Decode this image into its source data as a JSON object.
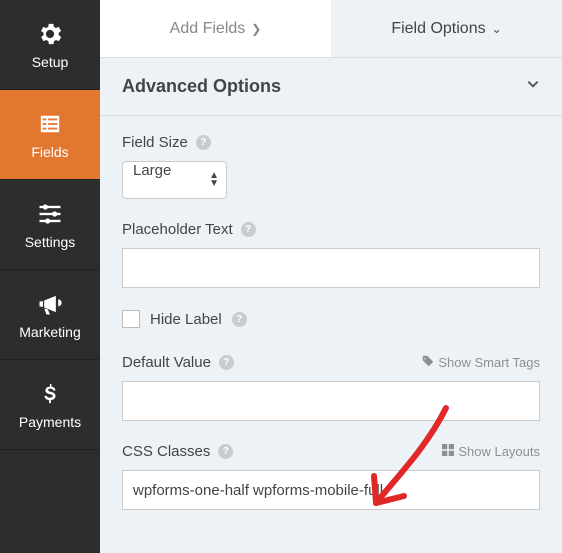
{
  "sidebar": {
    "items": [
      {
        "label": "Setup"
      },
      {
        "label": "Fields"
      },
      {
        "label": "Settings"
      },
      {
        "label": "Marketing"
      },
      {
        "label": "Payments"
      }
    ]
  },
  "tabs": {
    "add_fields": "Add Fields",
    "field_options": "Field Options"
  },
  "section": {
    "title": "Advanced Options"
  },
  "fields": {
    "size_label": "Field Size",
    "size_value": "Large",
    "placeholder_label": "Placeholder Text",
    "placeholder_value": "",
    "hide_label": "Hide Label",
    "default_label": "Default Value",
    "default_value": "",
    "css_label": "CSS Classes",
    "css_value": "wpforms-one-half wpforms-mobile-full",
    "show_smart_tags": "Show Smart Tags",
    "show_layouts": "Show Layouts"
  }
}
